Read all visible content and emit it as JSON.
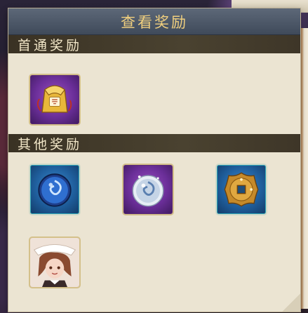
{
  "dialog": {
    "title": "查看奖励",
    "sections": [
      {
        "header": "首通奖励",
        "items": [
          {
            "icon": "gold-envelope-pouch-icon",
            "frame": "purple"
          }
        ]
      },
      {
        "header": "其他奖励",
        "items": [
          {
            "icon": "blue-swirl-orb-icon",
            "frame": "blue"
          },
          {
            "icon": "silver-swirl-orb-icon",
            "frame": "purple"
          },
          {
            "icon": "gold-coin-icon",
            "frame": "blue"
          },
          {
            "icon": "character-portrait-icon",
            "frame": "purple"
          }
        ]
      }
    ]
  },
  "colors": {
    "title_bar": "#4a5666",
    "title_text": "#f0cf7e",
    "section_header_bg": "#403728",
    "panel_bg": "#ebe4d2"
  }
}
